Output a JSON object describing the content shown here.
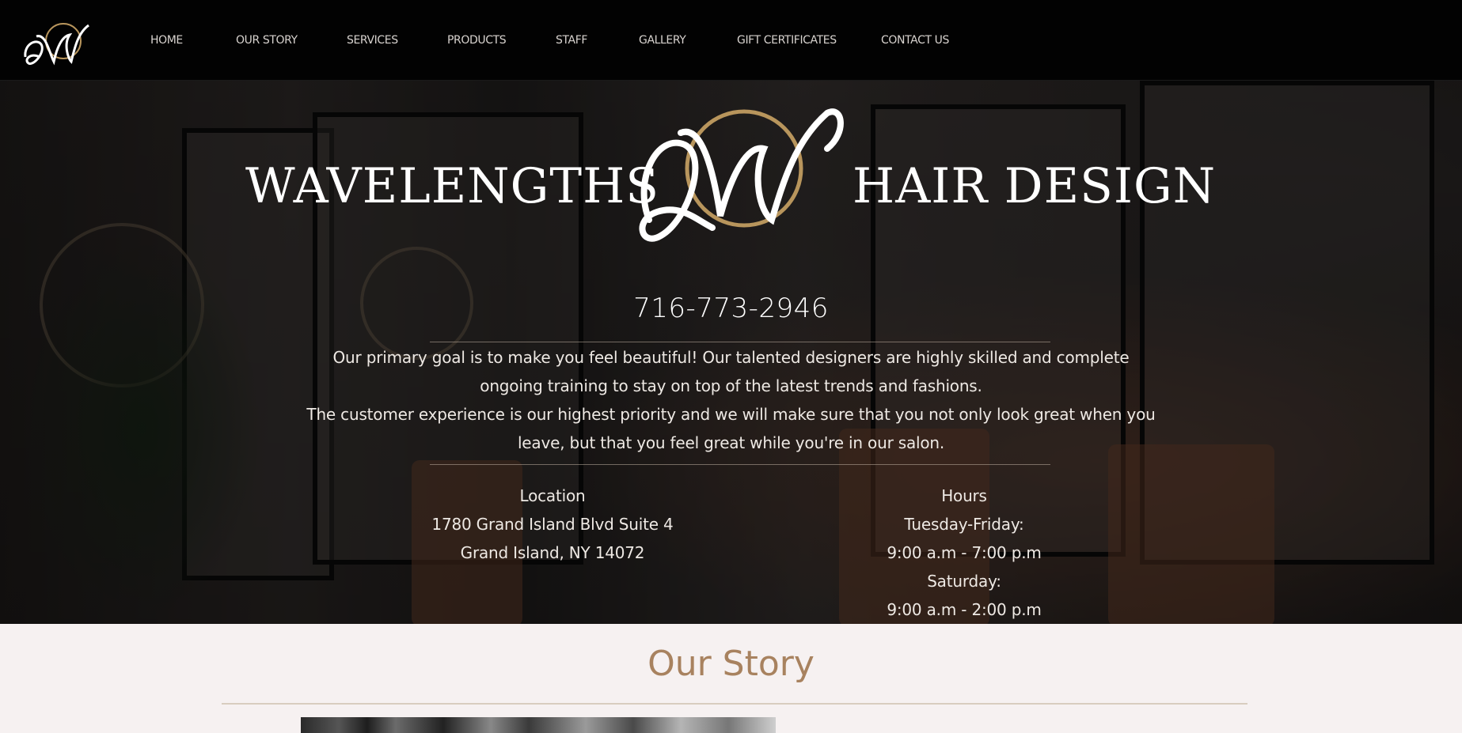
{
  "nav": {
    "logo_icon": "wavelengths-w-monogram-icon",
    "links": [
      {
        "label": "HOME"
      },
      {
        "label": "OUR STORY"
      },
      {
        "label": "SERVICES"
      },
      {
        "label": "PRODUCTS"
      },
      {
        "label": "STAFF"
      },
      {
        "label": "GALLERY"
      },
      {
        "label": "GIFT CERTIFICATES"
      },
      {
        "label": "CONTACT US"
      }
    ]
  },
  "hero": {
    "brand_left": "WAVELENGTHS",
    "brand_right": "HAIR DESIGN",
    "phone": "716-773-2946",
    "intro_1": "Our primary goal is to make you feel beautiful! Our talented designers are highly skilled and complete ongoing training to stay on top of the latest trends and fashions.",
    "intro_2": "The customer experience is our highest priority and we will make sure that you not only look great when you leave, but that you feel great while you're in our salon.",
    "location": {
      "heading": "Location",
      "line1": "1780 Grand Island Blvd Suite 4",
      "line2": "Grand Island, NY 14072"
    },
    "hours": {
      "heading": "Hours",
      "weekday_label": "Tuesday-Friday:",
      "weekday_hours": "9:00 a.m - 7:00 p.m",
      "saturday_label": "Saturday:",
      "saturday_hours": "9:00 a.m - 2:00 p.m"
    }
  },
  "story": {
    "title": "Our Story"
  },
  "colors": {
    "nav_bg": "#020202",
    "accent_gold": "#a8825f",
    "page_bg": "#f6f1f1"
  }
}
